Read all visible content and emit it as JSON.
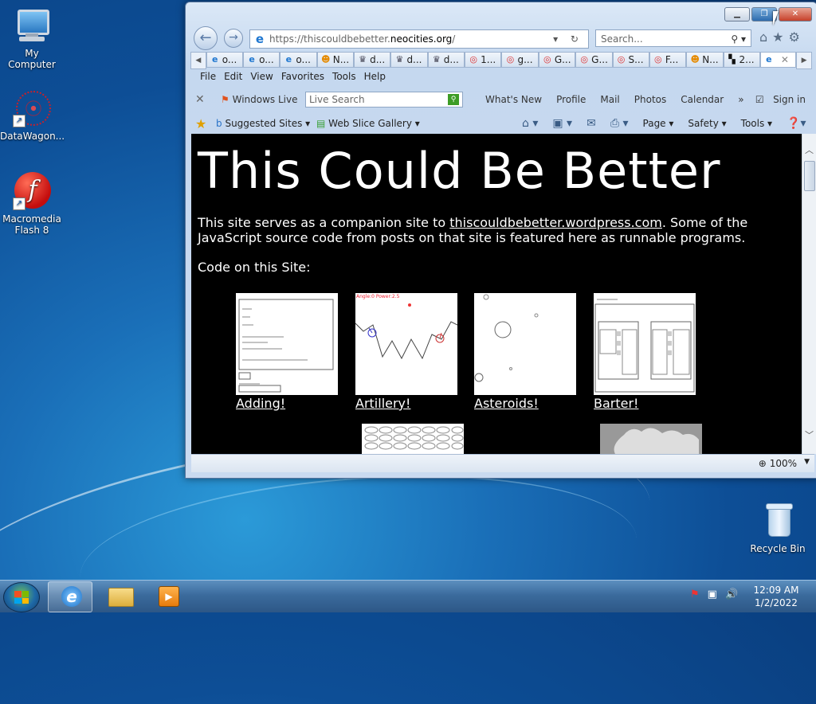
{
  "desktop": {
    "icons": [
      {
        "label": "My Computer"
      },
      {
        "label": "DataWagon..."
      },
      {
        "label": "Macromedia Flash 8"
      },
      {
        "label": "Recycle Bin"
      }
    ]
  },
  "browser": {
    "address": {
      "prefix": "https://thiscouldbebetter.",
      "host": "neocities.org",
      "suffix": "/"
    },
    "search_placeholder": "Search...",
    "tabs": [
      {
        "icon": "e",
        "label": "o..."
      },
      {
        "icon": "e",
        "label": "o..."
      },
      {
        "icon": "e",
        "label": "o..."
      },
      {
        "icon": "cat",
        "label": "N..."
      },
      {
        "icon": "crown",
        "label": "d..."
      },
      {
        "icon": "crown",
        "label": "d..."
      },
      {
        "icon": "crown",
        "label": "d..."
      },
      {
        "icon": "g",
        "label": "1..."
      },
      {
        "icon": "g",
        "label": "g..."
      },
      {
        "icon": "g",
        "label": "G..."
      },
      {
        "icon": "g",
        "label": "G..."
      },
      {
        "icon": "g",
        "label": "S..."
      },
      {
        "icon": "g",
        "label": "F..."
      },
      {
        "icon": "cat",
        "label": "N..."
      },
      {
        "icon": "grid",
        "label": "2..."
      }
    ],
    "menu": [
      "File",
      "Edit",
      "View",
      "Favorites",
      "Tools",
      "Help"
    ],
    "windows_live": {
      "brand": "Windows Live",
      "search_placeholder": "Live Search",
      "links": [
        "What's New",
        "Profile",
        "Mail",
        "Photos",
        "Calendar"
      ],
      "sign_in": "Sign in"
    },
    "favorites_bar": {
      "suggested": "Suggested Sites",
      "web_slice": "Web Slice Gallery",
      "commands": [
        "Page",
        "Safety",
        "Tools"
      ]
    },
    "zoom": "100%"
  },
  "page": {
    "title": "This Could Be Better",
    "intro_pre": "This site serves as a companion site to ",
    "intro_link": "thiscouldbebetter.wordpress.com",
    "intro_post": ". Some of the JavaScript source code from posts on that site is featured here as runnable programs.",
    "code_header": "Code on this Site:",
    "programs": [
      {
        "label": "Adding!"
      },
      {
        "label": "Artillery!"
      },
      {
        "label": "Asteroids!"
      },
      {
        "label": "Barter!"
      }
    ],
    "artillery_caption": "Angle:0 Power:2.5"
  },
  "taskbar": {
    "time": "12:09 AM",
    "date": "1/2/2022"
  }
}
